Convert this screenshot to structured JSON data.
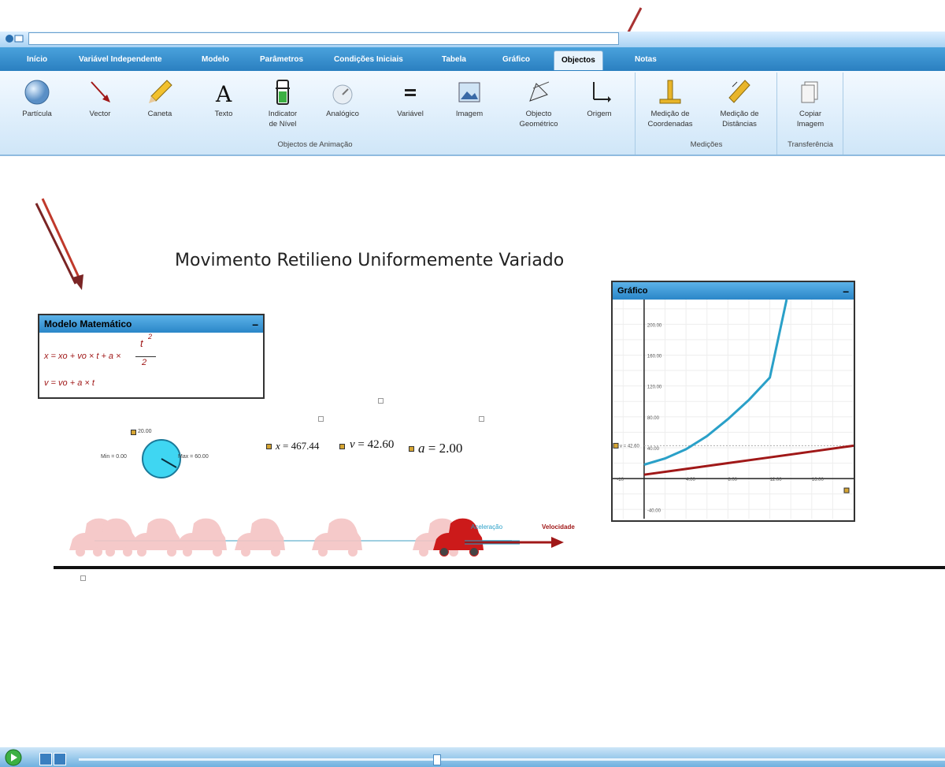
{
  "menu": {
    "tabs": [
      {
        "label": "Início"
      },
      {
        "label": "Variável Independente"
      },
      {
        "label": "Modelo"
      },
      {
        "label": "Parâmetros"
      },
      {
        "label": "Condições Iniciais"
      },
      {
        "label": "Tabela"
      },
      {
        "label": "Gráfico"
      },
      {
        "label": "Objectos"
      },
      {
        "label": "Notas"
      }
    ]
  },
  "ribbon": {
    "buttons": [
      {
        "label": "Partícula",
        "icon": "particle-icon"
      },
      {
        "label": "Vector",
        "icon": "vector-icon"
      },
      {
        "label": "Caneta",
        "icon": "pencil-icon"
      },
      {
        "label": "Texto",
        "icon": "text-icon"
      },
      {
        "label": "Indicator\nde Nível",
        "icon": "level-indicator-icon"
      },
      {
        "label": "Analógico",
        "icon": "analog-gauge-icon"
      },
      {
        "label": "Variável",
        "icon": "variable-icon"
      },
      {
        "label": "Imagem",
        "icon": "image-icon"
      },
      {
        "label": "Objecto\nGeométrico",
        "icon": "geometric-object-icon"
      },
      {
        "label": "Origem",
        "icon": "origin-icon"
      },
      {
        "label": "Medição de\nCoordenadas",
        "icon": "coordinate-measure-icon"
      },
      {
        "label": "Medição de\nDistâncias",
        "icon": "distance-measure-icon"
      },
      {
        "label": "Copiar\nImagem",
        "icon": "copy-image-icon"
      }
    ],
    "groups": [
      {
        "label": "Objectos de Animação"
      },
      {
        "label": "Medições"
      },
      {
        "label": "Transferência"
      }
    ]
  },
  "canvas": {
    "title": "Movimento Retilieno Uniformemente Variado",
    "model_panel": {
      "title": "Modelo Matemático",
      "minimize": "–",
      "eq1": "x = xo + vo × t + a ×",
      "eq1_num": "t",
      "eq1_exp": "2",
      "eq1_den": "2",
      "eq2": "v = vo + a × t"
    },
    "gauge": {
      "value": "20.00",
      "min": "Min = 0.00",
      "max": "Max = 60.00"
    },
    "variables": {
      "x": "467.44",
      "v": "42.60",
      "a": "2.00",
      "x_sym": "x",
      "v_sym": "v",
      "a_sym": "a"
    },
    "car": {
      "accel_label": "Aceleração",
      "vel_label": "Velocidade"
    }
  },
  "graph_panel": {
    "title": "Gráfico",
    "minimize": "–",
    "v_marker": "v = 42.60"
  },
  "chart_data": {
    "type": "line",
    "x_ticks": [
      "-10",
      "4.00",
      "8.00",
      "12.00",
      "16.00"
    ],
    "y_ticks": [
      "200.00",
      "160.00",
      "120.00",
      "80.00",
      "40.00",
      "-40.00"
    ],
    "xlim": [
      -3,
      20
    ],
    "ylim": [
      -52,
      232
    ],
    "series": [
      {
        "color": "#2aa0c8",
        "x": [
          0,
          2,
          4,
          6,
          8,
          10,
          12,
          13.6
        ],
        "y": [
          18,
          26,
          38,
          55,
          77,
          102,
          131,
          232
        ]
      },
      {
        "color": "#a01818",
        "x": [
          0,
          4,
          8,
          12,
          16,
          20
        ],
        "y": [
          5,
          12.5,
          20,
          27.5,
          35,
          42.6
        ]
      }
    ],
    "reference_y": 42.6,
    "grid": true
  },
  "colors": {
    "accent": "#2a86c8",
    "position": "#2aa0c8",
    "velocity": "#a01818"
  }
}
